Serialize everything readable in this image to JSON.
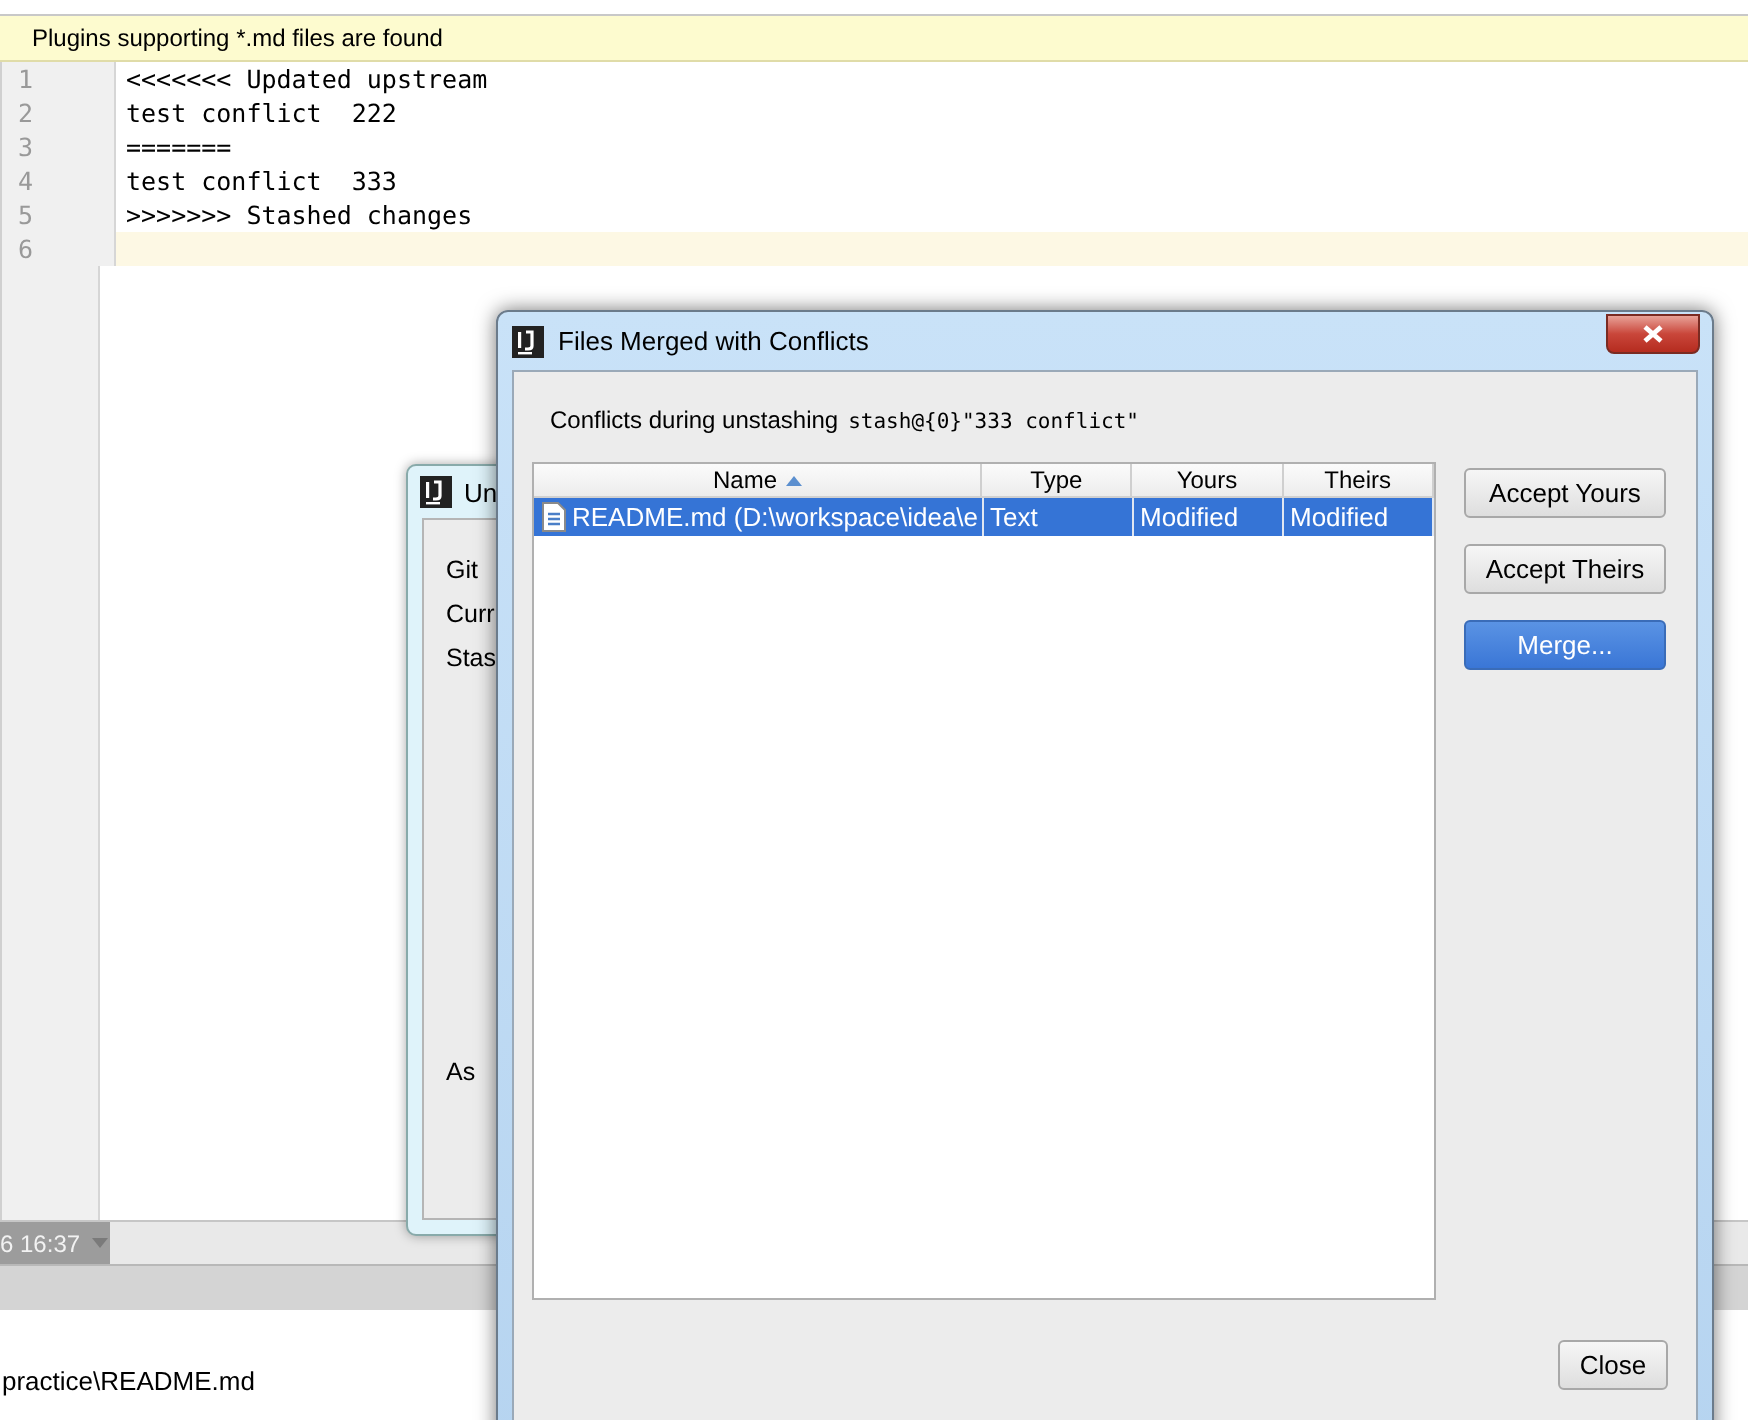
{
  "notification": {
    "text": "Plugins supporting *.md files are found"
  },
  "editor": {
    "lines": [
      {
        "number": "1",
        "text": "<<<<<<< Updated upstream",
        "current": false
      },
      {
        "number": "2",
        "text": "test conflict  222",
        "current": false
      },
      {
        "number": "3",
        "text": "=======",
        "current": false
      },
      {
        "number": "4",
        "text": "test conflict  333",
        "current": false
      },
      {
        "number": "5",
        "text": ">>>>>>> Stashed changes",
        "current": false
      },
      {
        "number": "6",
        "current": true
      }
    ]
  },
  "status_tab": {
    "text": "6 16:37"
  },
  "bottom_text": "practice\\README.md",
  "back_dialog": {
    "title": "Un",
    "lines": [
      "Git",
      "Curr",
      "Stas"
    ],
    "footer": "As"
  },
  "dialog": {
    "title": "Files Merged with Conflicts",
    "message": "Conflicts during unstashing",
    "stash_ref": "stash@{0}\"333 conflict\"",
    "table": {
      "columns": [
        {
          "label": "Name",
          "sorted": true
        },
        {
          "label": "Type",
          "sorted": false
        },
        {
          "label": "Yours",
          "sorted": false
        },
        {
          "label": "Theirs",
          "sorted": false
        }
      ],
      "rows": [
        {
          "cells": [
            "README.md (D:\\workspace\\idea\\e",
            "Text",
            "Modified",
            "Modified"
          ],
          "selected": true
        }
      ]
    },
    "buttons": [
      {
        "label": "Accept Yours",
        "default": false
      },
      {
        "label": "Accept Theirs",
        "default": false
      },
      {
        "label": "Merge...",
        "default": true
      }
    ],
    "close_button": "Close"
  }
}
